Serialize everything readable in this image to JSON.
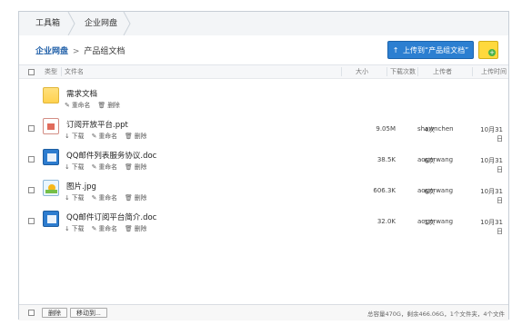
{
  "tabs": {
    "toolbox": "工具箱",
    "enterprise": "企业网盘"
  },
  "header": {
    "path_root": "企业网盘",
    "path_separator": ">",
    "path_current": "产品组文档",
    "upload_label": "上传到“产品组文档”",
    "upload_icon": "upload-arrow-icon",
    "new_folder_icon": "new-folder-icon"
  },
  "table": {
    "columns": {
      "type": "类型",
      "name": "文件名",
      "size": "大小",
      "downloads": "下载次数",
      "uploader": "上传者",
      "time": "上传时间"
    },
    "rows": [
      {
        "icon": "folder-icon",
        "name": "需求文档",
        "actions": [
          "重命名",
          "删除"
        ],
        "size": "",
        "downloads": "",
        "uploader": "",
        "time": ""
      },
      {
        "icon": "ppt-file-icon",
        "name": "订阅开放平台.ppt",
        "actions": [
          "下载",
          "重命名",
          "删除"
        ],
        "size": "9.05M",
        "downloads": "4次",
        "uploader": "shawnchen",
        "time": "10月31日"
      },
      {
        "icon": "doc-file-icon",
        "name": "QQ邮件列表服务协议.doc",
        "actions": [
          "下载",
          "重命名",
          "删除"
        ],
        "size": "38.5K",
        "downloads": "6次",
        "uploader": "aogerwang",
        "time": "10月31日"
      },
      {
        "icon": "image-file-icon",
        "name": "图片.jpg",
        "actions": [
          "下载",
          "重命名",
          "删除"
        ],
        "size": "606.3K",
        "downloads": "6次",
        "uploader": "aogerwang",
        "time": "10月31日"
      },
      {
        "icon": "doc-file-icon",
        "name": "QQ邮件订阅平台简介.doc",
        "actions": [
          "下载",
          "重命名",
          "删除"
        ],
        "size": "32.0K",
        "downloads": "1次",
        "uploader": "aogerwang",
        "time": "10月31日"
      }
    ]
  },
  "footer": {
    "delete_label": "删除",
    "move_label": "移动到...",
    "capacity": "总容量470G，剩余466.06G，1个文件夹，4个文件"
  },
  "colors": {
    "primary": "#2c7fd1",
    "link": "#1f5fa8",
    "folder": "#ffd24f",
    "success": "#49b24a"
  }
}
